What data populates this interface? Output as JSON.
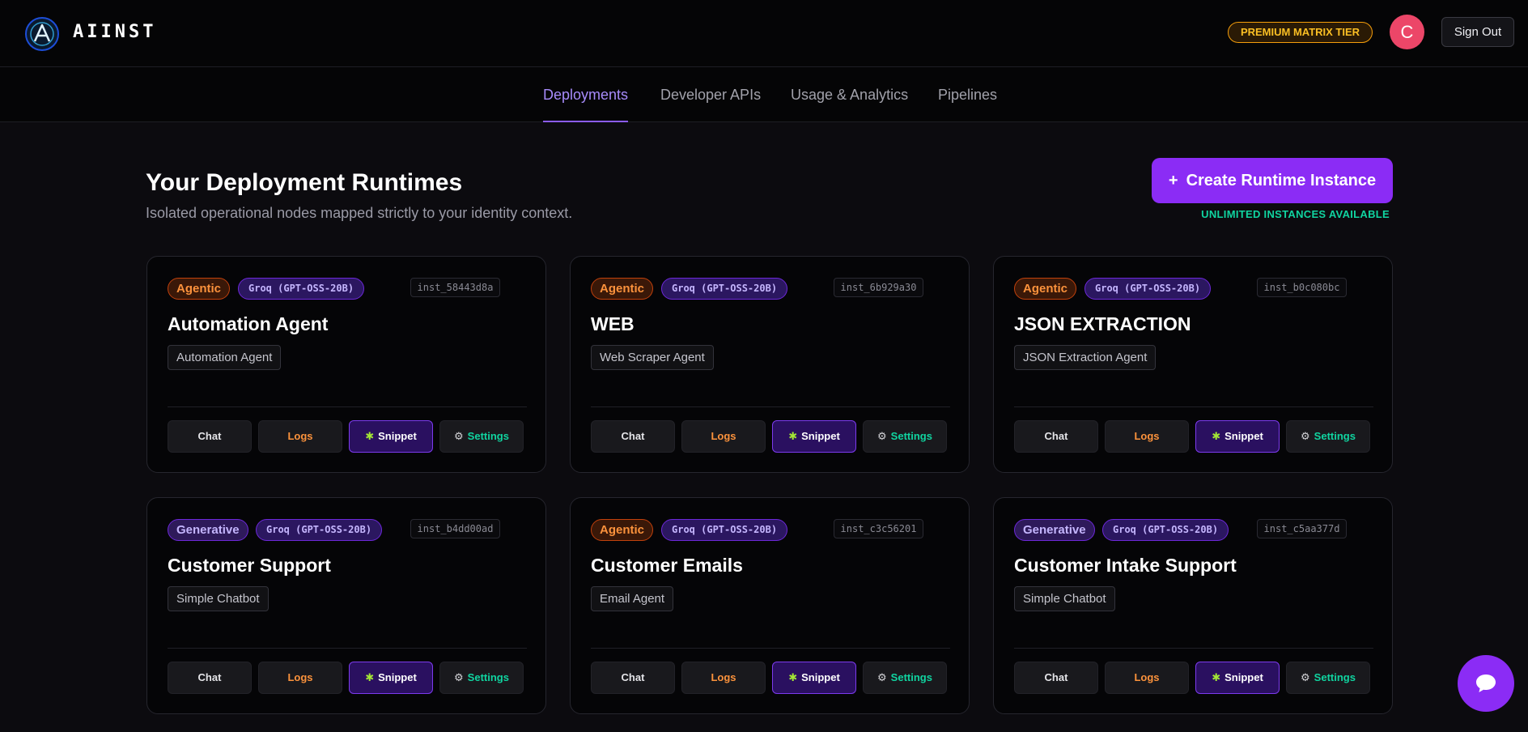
{
  "header": {
    "brand": "AIINST",
    "tier_badge": "PREMIUM MATRIX TIER",
    "avatar_letter": "C",
    "sign_out": "Sign Out"
  },
  "nav": {
    "tabs": [
      {
        "label": "Deployments",
        "active": true
      },
      {
        "label": "Developer APIs",
        "active": false
      },
      {
        "label": "Usage & Analytics",
        "active": false
      },
      {
        "label": "Pipelines",
        "active": false
      }
    ]
  },
  "main": {
    "title": "Your Deployment Runtimes",
    "subtitle": "Isolated operational nodes mapped strictly to your identity context.",
    "create_button": "Create Runtime Instance",
    "create_button_icon": "+",
    "instances_note": "UNLIMITED INSTANCES AVAILABLE"
  },
  "actions": {
    "chat": "Chat",
    "logs": "Logs",
    "snippet": "Snippet",
    "settings": "Settings",
    "snippet_icon": "puzzle-icon",
    "settings_icon": "gear-icon"
  },
  "cards": [
    {
      "type": "Agentic",
      "model": "Groq (GPT-OSS-20B)",
      "id": "inst_58443d8a",
      "title": "Automation Agent",
      "agent_type": "Automation Agent"
    },
    {
      "type": "Agentic",
      "model": "Groq (GPT-OSS-20B)",
      "id": "inst_6b929a30",
      "title": "WEB",
      "agent_type": "Web Scraper Agent"
    },
    {
      "type": "Agentic",
      "model": "Groq (GPT-OSS-20B)",
      "id": "inst_b0c080bc",
      "title": "JSON EXTRACTION",
      "agent_type": "JSON Extraction Agent"
    },
    {
      "type": "Generative",
      "model": "Groq (GPT-OSS-20B)",
      "id": "inst_b4dd00ad",
      "title": "Customer Support",
      "agent_type": "Simple Chatbot"
    },
    {
      "type": "Agentic",
      "model": "Groq (GPT-OSS-20B)",
      "id": "inst_c3c56201",
      "title": "Customer Emails",
      "agent_type": "Email Agent"
    },
    {
      "type": "Generative",
      "model": "Groq (GPT-OSS-20B)",
      "id": "inst_c5aa377d",
      "title": "Customer Intake Support",
      "agent_type": "Simple Chatbot"
    }
  ],
  "colors": {
    "accent": "#8b2cf5",
    "agentic": "#fb923c",
    "generative": "#c4b5fd",
    "success": "#10d4a0",
    "avatar": "#ec4668"
  }
}
